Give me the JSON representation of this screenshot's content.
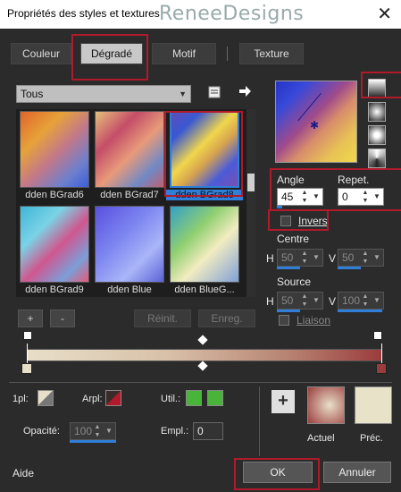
{
  "window": {
    "title": "Propriétés des styles et textures",
    "watermark": "ReneeDesigns",
    "close": "✕"
  },
  "tabs": [
    {
      "label": "Couleur"
    },
    {
      "label": "Dégradé"
    },
    {
      "label": "Motif"
    },
    {
      "label": "Texture"
    }
  ],
  "category": {
    "value": "Tous"
  },
  "gradients": [
    {
      "label": "dden BGrad6"
    },
    {
      "label": "dden BGrad7"
    },
    {
      "label": "dden BGrad8"
    },
    {
      "label": "dden BGrad9"
    },
    {
      "label": "dden Blue"
    },
    {
      "label": "dden BlueG..."
    }
  ],
  "list_buttons": {
    "add": "+",
    "remove": "-",
    "reset": "Réinit.",
    "save": "Enreg."
  },
  "angle": {
    "label": "Angle",
    "value": "45"
  },
  "repeat": {
    "label": "Repet.",
    "value": "0"
  },
  "invert": {
    "label": "Invers",
    "checked": false
  },
  "center": {
    "label": "Centre",
    "h_label": "H",
    "h": "50",
    "v_label": "V",
    "v": "50"
  },
  "source": {
    "label": "Source",
    "h_label": "H",
    "h": "50",
    "v_label": "V",
    "v": "100",
    "link_label": "Liaison"
  },
  "stops": {
    "first_label": "1pl:",
    "arpl_label": "Arpl:",
    "util_label": "Util.:",
    "opacity_label": "Opacité:",
    "opacity_value": "100",
    "empl_label": "Empl.:",
    "empl_value": "0"
  },
  "swatches": {
    "current_label": "Actuel",
    "previous_label": "Préc.",
    "current_color": "#c8a39a",
    "previous_color": "#e8e2c8"
  },
  "footer": {
    "help": "Aide",
    "ok": "OK",
    "cancel": "Annuler"
  },
  "colors": {
    "accent_red": "#b01a2a",
    "selection_blue": "#2f7fd8",
    "util_green": "#48b43a"
  }
}
